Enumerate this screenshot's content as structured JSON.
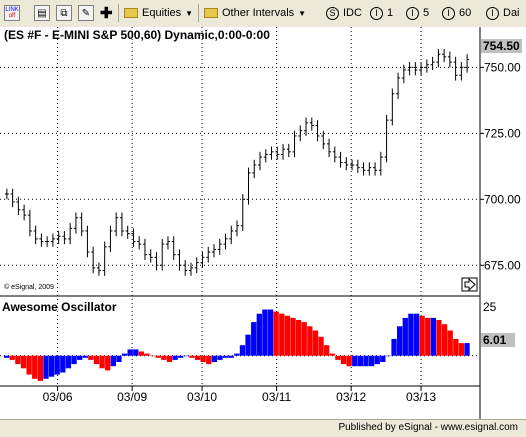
{
  "toolbar": {
    "link_label": "LINK",
    "link_sub": "off",
    "plus_glyph": "✚",
    "equities_label": "Equities",
    "intervals_label": "Other Intervals",
    "idc_label": "IDC",
    "i1_label": "1",
    "i5_label": "5",
    "i60_label": "60",
    "daily_label": "Dai",
    "icon_letter": "I"
  },
  "chart": {
    "title": "(ES #F - E-MINI S&P 500,60) Dynamic,0:00-0:00",
    "copyright": "© eSignal, 2009",
    "indicator_title": "Awesome Oscillator",
    "price_ticks": [
      "750.00",
      "725.00",
      "700.00",
      "675.00"
    ],
    "price_tick_values": [
      750,
      725,
      700,
      675
    ],
    "last_price": "754.50",
    "osc_tick": "25",
    "osc_last": "6.01",
    "dates": [
      "03/06",
      "03/09",
      "03/10",
      "03/11",
      "03/12",
      "03/13"
    ],
    "price_range": [
      666,
      760
    ],
    "osc_range": [
      -13,
      27
    ],
    "colors": {
      "up": "#0000ff",
      "down": "#ff0000",
      "price": "#000000",
      "badge": "#c0c0c0"
    }
  },
  "chart_data": {
    "type": "bar",
    "title": "(ES #F - E-MINI S&P 500,60) Dynamic,0:00-0:00",
    "xlabel": "",
    "ylabel": "",
    "x": [
      "03/06",
      "03/09",
      "03/10",
      "03/11",
      "03/12",
      "03/13"
    ],
    "price_series": [
      702,
      699,
      696,
      694,
      688,
      685,
      684,
      684,
      685,
      686,
      685,
      689,
      693,
      688,
      680,
      674,
      673,
      682,
      688,
      693,
      688,
      687,
      684,
      683,
      679,
      678,
      675,
      683,
      684,
      679,
      675,
      673,
      674,
      676,
      678,
      680,
      681,
      683,
      685,
      688,
      690,
      700,
      710,
      713,
      716,
      717,
      718,
      717,
      719,
      718,
      724,
      726,
      729,
      728,
      724,
      721,
      718,
      716,
      714,
      713,
      713,
      712,
      711,
      712,
      711,
      716,
      730,
      740,
      746,
      749,
      750,
      749,
      750,
      751,
      752,
      755,
      754,
      752,
      747,
      750,
      753
    ],
    "awesome_oscillator": [
      -1,
      -2,
      -4,
      -6,
      -9,
      -11,
      -12,
      -11,
      -10,
      -9,
      -8,
      -6,
      -4,
      -2,
      -1,
      -2,
      -4,
      -6,
      -7,
      -5,
      -3,
      1,
      3,
      3,
      2,
      1,
      0,
      -1,
      -2,
      -3,
      -2,
      -1,
      0,
      -1,
      -2,
      -3,
      -4,
      -3,
      -2,
      -1,
      -1,
      1,
      5,
      10,
      16,
      20,
      22,
      22,
      21,
      20,
      19,
      18,
      17,
      16,
      14,
      12,
      9,
      5,
      1,
      -2,
      -4,
      -5,
      -5,
      -5,
      -5,
      -5,
      -4,
      -3,
      0,
      8,
      14,
      18,
      20,
      20,
      19,
      18,
      18,
      17,
      15,
      12,
      8,
      6,
      6
    ],
    "ylim": [
      666,
      760
    ]
  }
}
